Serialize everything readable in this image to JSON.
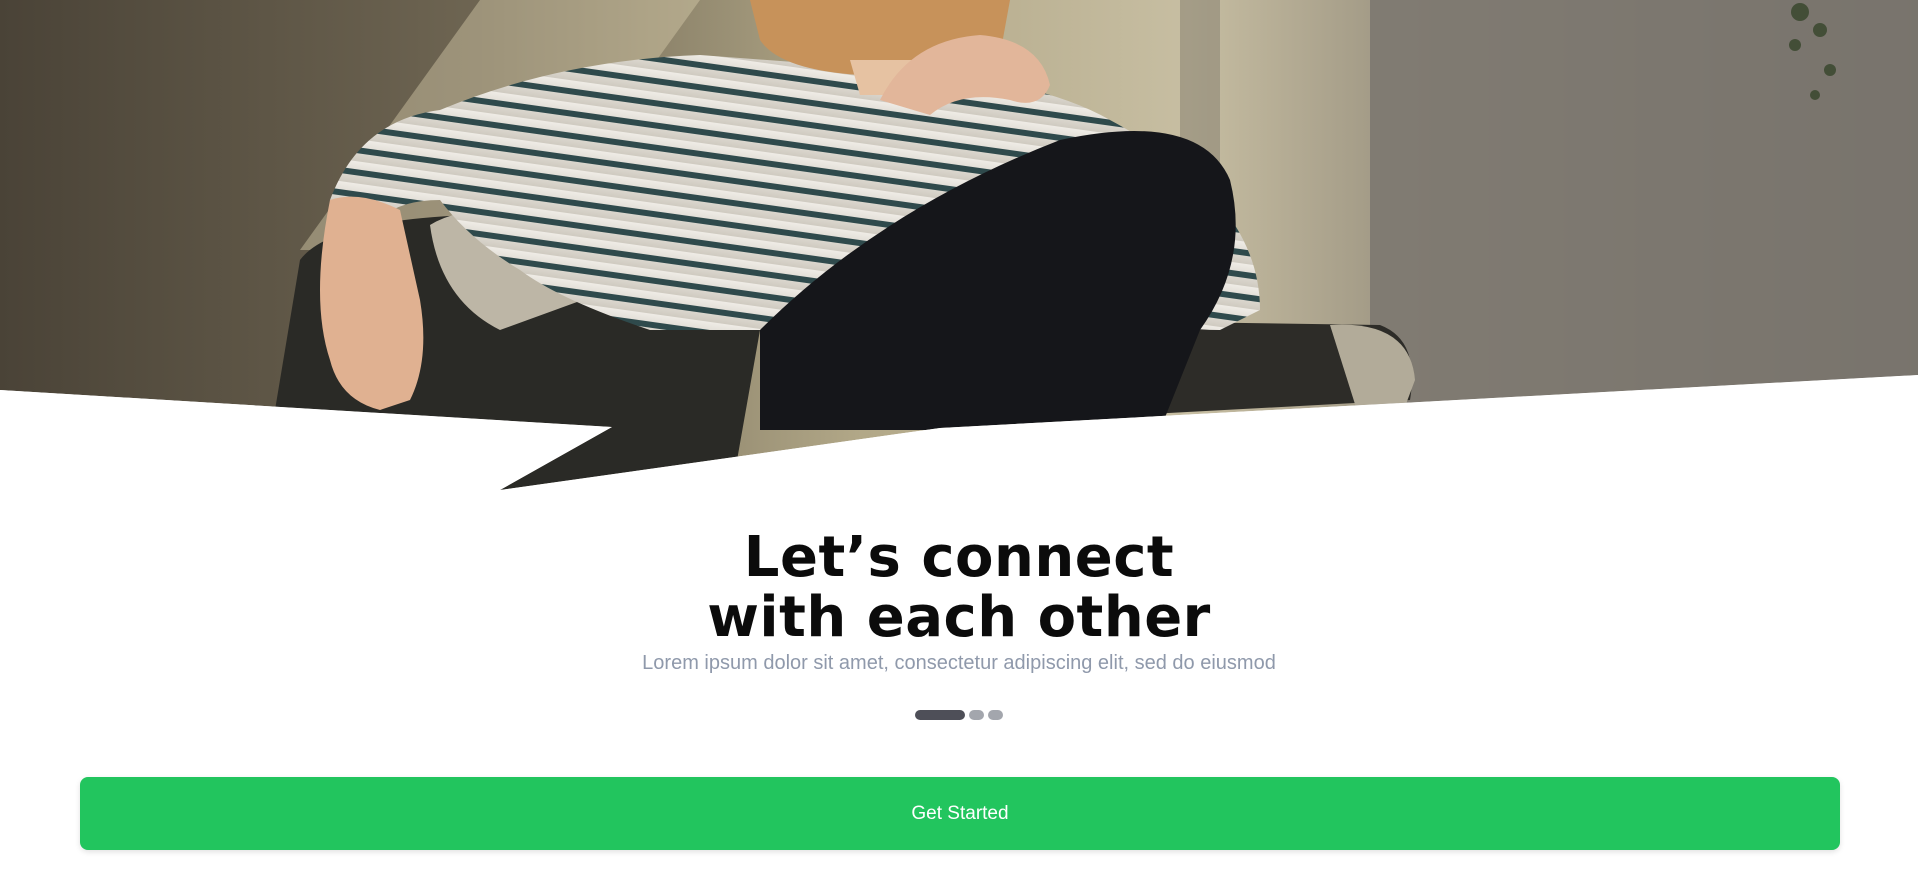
{
  "hero": {
    "image_description_icon": "hero-photo"
  },
  "content": {
    "title_line1": "Let’s connect",
    "title_line2": "with each other",
    "subtitle": "Lorem ipsum dolor sit amet, consectetur adipiscing elit, sed do eiusmod"
  },
  "pagination": {
    "total": 3,
    "active_index": 0
  },
  "cta": {
    "label": "Get Started",
    "color": "#22c55e"
  },
  "colors": {
    "title": "#0b0b0b",
    "subtitle": "#8f99ab",
    "dot_active": "#4e4f58",
    "dot_inactive": "#a3a6ad"
  }
}
